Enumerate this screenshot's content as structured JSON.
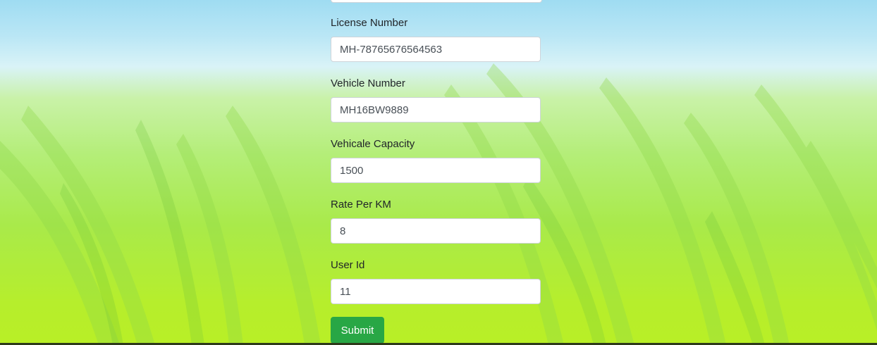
{
  "form": {
    "license_number": {
      "label": "License Number",
      "value": "MH-78765676564563"
    },
    "vehicle_number": {
      "label": "Vehicle Number",
      "value": "MH16BW9889"
    },
    "vehicle_capacity": {
      "label": "Vehicale Capacity",
      "value": "1500"
    },
    "rate_per_km": {
      "label": "Rate Per KM",
      "value": "8"
    },
    "user_id": {
      "label": "User Id",
      "value": "11"
    },
    "submit_label": "Submit"
  },
  "colors": {
    "submit_bg": "#28a745",
    "sky": "#9fdcf2",
    "grass": "#b6ee2c"
  }
}
